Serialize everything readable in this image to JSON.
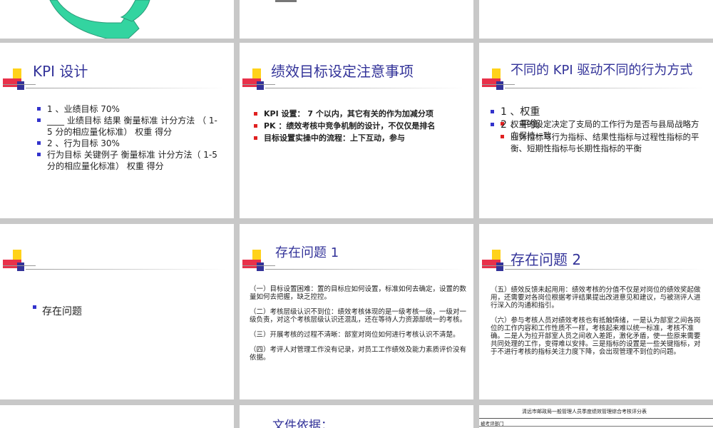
{
  "slides": {
    "kpi": {
      "title": "KPI 设计",
      "items": [
        "1 、业绩目标   70%",
        "____ 业绩目标  结果  衡量标准  计分方法 （ 1-5 分的相应量化标准）  权重  得分",
        "2 、行为目标   30%",
        "        行为目标   关键例子   衡量标准  计分方法（ 1-5 分的相应量化标准）  权重  得分"
      ]
    },
    "goal": {
      "title": "绩效目标设定注意事项",
      "items": [
        "KPI 设置： 7 个以内，其它有关的作为加减分项",
        "PK ：绩效考核中竞争机制的设计，不仅仅是排名",
        "目标设置实操中的流程：上下互动，参与"
      ]
    },
    "drive": {
      "title": "不同的 KPI 驱动不同的行为方式",
      "groups": [
        {
          "label": "1 、权重",
          "sub": "权重的设定决定了支局的工作行为是否与县局战略方向保持一致"
        },
        {
          "label": "2 、平衡",
          "sub": "业务指标与行为指标、结果性指标与过程性指标的平衡、短期性指标与长期性指标的平衡"
        }
      ]
    },
    "issues": {
      "item": "存在问题"
    },
    "issues1": {
      "title": "存在问题 1",
      "paras": [
        "（一）目标设置困难：置的目标应如何设置，标准如何去确定，设置的数量如何去把握，缺乏控控。",
        "（二）考核层级认识不到位：绩效考核体现的是一级考核一级，一级对一级负责，对这个考核层级认识还混乱，还在等待人力资源部统一的考核。",
        "（三）开展考核的过程不清晰：部室对岗位如何进行考核认识不清楚。",
        "（四）考评人对管理工作没有记录，对员工工作绩效及能力素质评价没有依据。"
      ]
    },
    "issues2": {
      "title": "存在问题 2",
      "paras": [
        "（五）绩效反馈未起用用：绩效考核的分值不仅是对岗位的绩效奖起做用，还需要对各岗位根据考评结果提出改进意见和建议，与被测评人进行深入的沟通和指引。",
        "（六）参与考核人员对绩效考核也有抵触情绪，一是认为部室之间各岗位的工作内容和工作性质不一样，考核起来难以统一标准，考核不准确。二是人为拉开部室人员之间收入差距，激化矛盾，使一些原来需要共同处理的工作，变得难以安排。三是指标的设置是一些关键指标，对于不进行考核的指标关注力度下降，会出现管理不到位的问题。"
      ]
    },
    "basis": {
      "title": "文件依据："
    },
    "table": {
      "caption": "清远市邮政局一般管理人员季度绩效管理综合考核评分表",
      "header": "被考评部门"
    }
  },
  "colors": {
    "title": "#333399",
    "bullet_blue": "#3333cc",
    "bullet_red": "#e02020",
    "arrow": "#33d4a0"
  }
}
